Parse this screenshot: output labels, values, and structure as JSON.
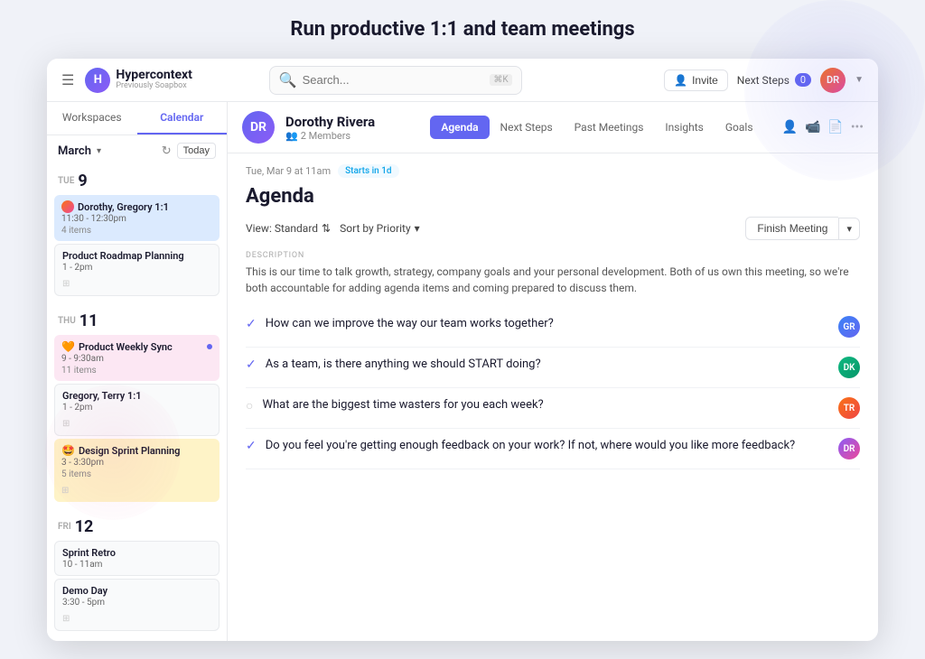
{
  "page": {
    "title": "Run productive 1:1 and team meetings"
  },
  "topbar": {
    "logo_name": "Hypercontext",
    "logo_sub": "Previously Soapbox",
    "logo_initial": "H",
    "search_placeholder": "Search...",
    "search_shortcut": "⌘K",
    "invite_label": "Invite",
    "next_steps_label": "Next Steps",
    "next_steps_count": "0",
    "avatar_initials": "DR"
  },
  "sidebar": {
    "tab_workspaces": "Workspaces",
    "tab_calendar": "Calendar",
    "month_label": "March",
    "today_label": "Today",
    "days": [
      {
        "day_abbr": "TUE",
        "day_num": "9",
        "events": [
          {
            "title": "Dorothy, Gregory 1:1",
            "time": "11:30 - 12:30pm",
            "count": "4 items",
            "style": "blue",
            "has_avatar": true,
            "has_dot": false
          },
          {
            "title": "Product Roadmap Planning",
            "time": "1 - 2pm",
            "style": "white",
            "has_icon": true
          }
        ]
      },
      {
        "day_abbr": "THU",
        "day_num": "11",
        "events": [
          {
            "title": "Product Weekly Sync",
            "emoji": "🧡",
            "time": "9 - 9:30am",
            "count": "11 items",
            "style": "pink",
            "has_dot": true
          },
          {
            "title": "Gregory, Terry 1:1",
            "time": "1 - 2pm",
            "style": "white",
            "has_icon": true
          },
          {
            "title": "Design Sprint Planning",
            "emoji": "🤩",
            "time": "3 - 3:30pm",
            "count": "5 items",
            "style": "yellow",
            "has_icon": true
          }
        ]
      },
      {
        "day_abbr": "FRI",
        "day_num": "12",
        "events": [
          {
            "title": "Sprint Retro",
            "time": "10 - 11am",
            "style": "white"
          },
          {
            "title": "Demo Day",
            "time": "3:30 - 5pm",
            "style": "white",
            "has_icon": true
          }
        ]
      }
    ]
  },
  "meeting": {
    "name": "Dorothy Rivera",
    "members": "2 Members",
    "avatar_initials": "DR",
    "tabs": [
      "Agenda",
      "Next Steps",
      "Past Meetings",
      "Insights",
      "Goals"
    ],
    "active_tab": "Agenda",
    "date_label": "Tue, Mar 9 at 11am",
    "starts_label": "Starts in 1d",
    "agenda_title": "Agenda",
    "view_label": "View: Standard",
    "sort_label": "Sort by Priority",
    "finish_btn": "Finish Meeting",
    "description_label": "DESCRIPTION",
    "description_text": "This is our time to talk growth, strategy, company goals and your personal development. Both of us own this meeting, so we're both accountable for adding agenda items and coming prepared to discuss them.",
    "items": [
      {
        "checked": true,
        "text": "How can we improve the way our team works together?",
        "avatar_style": "av-blue",
        "avatar_initials": "GR"
      },
      {
        "checked": true,
        "text": "As a team, is there anything we should START doing?",
        "avatar_style": "av-green",
        "avatar_initials": "DK"
      },
      {
        "checked": false,
        "text": "What are the biggest time wasters for you each week?",
        "avatar_style": "av-orange",
        "avatar_initials": "TR"
      },
      {
        "checked": true,
        "text": "Do you feel you're getting enough feedback on your work? If not, where would you like more feedback?",
        "avatar_style": "av-purple",
        "avatar_initials": "DR"
      }
    ]
  }
}
